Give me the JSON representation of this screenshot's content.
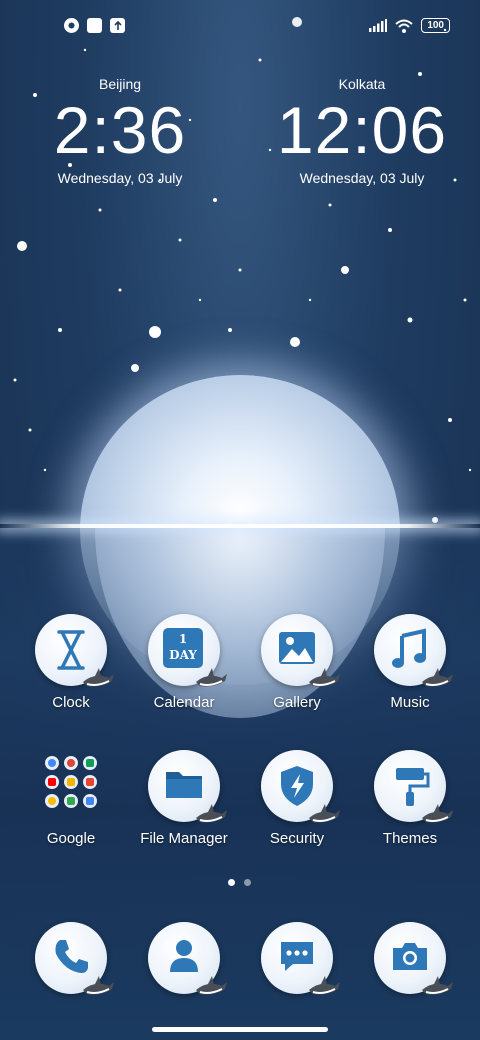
{
  "status_bar": {
    "left_icons": [
      "app-notification-icon",
      "square-notification-icon",
      "upload-notification-icon"
    ],
    "right_icons": [
      "signal-icon",
      "wifi-icon",
      "battery-icon"
    ],
    "battery": "100"
  },
  "clocks": [
    {
      "city": "Beijing",
      "time": "2:36",
      "date": "Wednesday, 03 July"
    },
    {
      "city": "Kolkata",
      "time": "12:06",
      "date": "Wednesday, 03 July"
    }
  ],
  "apps_row1": [
    {
      "label": "Clock",
      "icon": "hourglass-icon"
    },
    {
      "label": "Calendar",
      "icon": "calendar-icon",
      "badge": "1 DAY"
    },
    {
      "label": "Gallery",
      "icon": "image-icon"
    },
    {
      "label": "Music",
      "icon": "music-note-icon"
    }
  ],
  "apps_row2": [
    {
      "label": "Google",
      "icon": "google-folder-icon"
    },
    {
      "label": "File Manager",
      "icon": "folder-icon"
    },
    {
      "label": "Security",
      "icon": "shield-icon"
    },
    {
      "label": "Themes",
      "icon": "paint-roller-icon"
    }
  ],
  "dock": [
    {
      "name": "Phone",
      "icon": "phone-icon"
    },
    {
      "name": "Contacts",
      "icon": "contact-icon"
    },
    {
      "name": "Messages",
      "icon": "message-icon"
    },
    {
      "name": "Camera",
      "icon": "camera-icon"
    }
  ],
  "page_indicator": {
    "pages": 2,
    "current": 1
  },
  "colors": {
    "icon_blue": "#2f78b8",
    "bg_dark": "#17304f",
    "bubble": "#eef4fb"
  }
}
